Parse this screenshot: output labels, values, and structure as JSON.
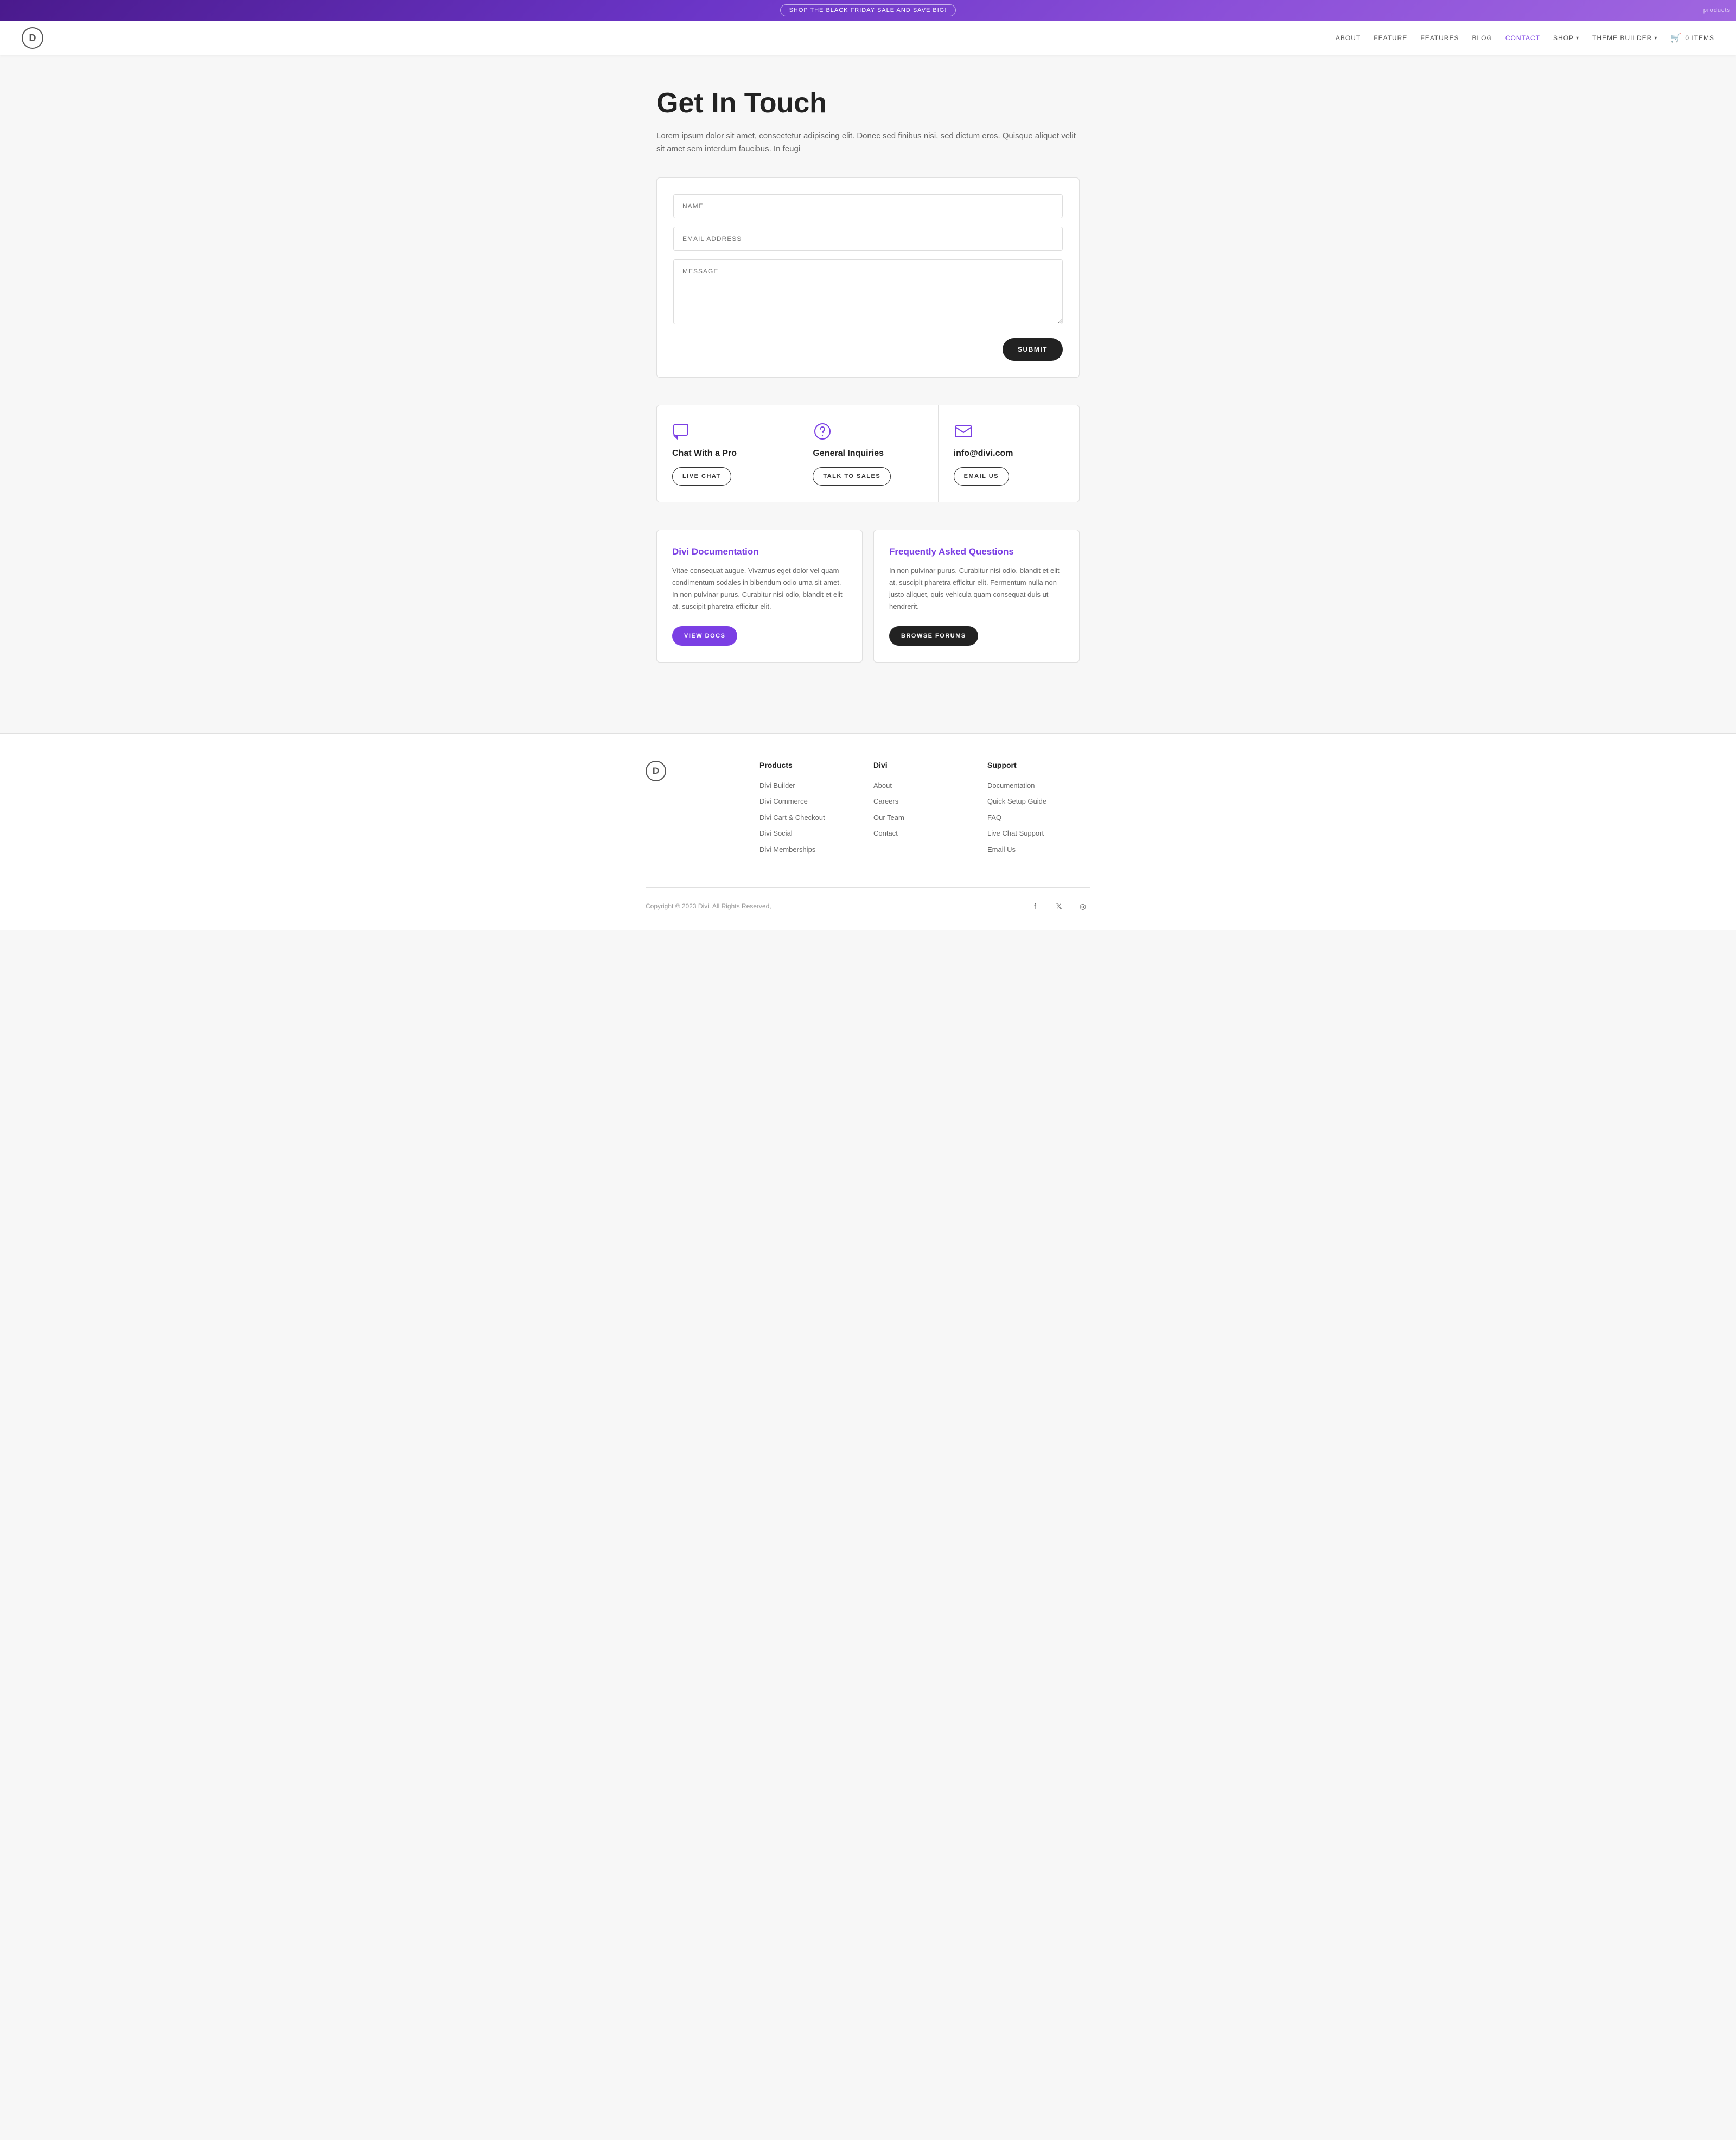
{
  "banner": {
    "text": "SHOP THE BLACK FRIDAY SALE AND SAVE BIG!",
    "corner": "products"
  },
  "header": {
    "logo": "D",
    "nav": [
      {
        "label": "ABOUT",
        "active": false,
        "href": "#"
      },
      {
        "label": "FEATURE",
        "active": false,
        "href": "#"
      },
      {
        "label": "FEATURES",
        "active": false,
        "href": "#"
      },
      {
        "label": "BLOG",
        "active": false,
        "href": "#"
      },
      {
        "label": "CONTACT",
        "active": true,
        "href": "#"
      },
      {
        "label": "SHOP",
        "active": false,
        "href": "#",
        "hasChevron": true
      },
      {
        "label": "THEME BUILDER",
        "active": false,
        "href": "#",
        "hasChevron": true
      }
    ],
    "cart": {
      "label": "0 ITEMS"
    }
  },
  "hero": {
    "title": "Get In Touch",
    "description": "Lorem ipsum dolor sit amet, consectetur adipiscing elit. Donec sed finibus nisi, sed dictum eros. Quisque aliquet velit sit amet sem interdum faucibus. In feugi"
  },
  "form": {
    "name_placeholder": "NAME",
    "email_placeholder": "EMAIL ADDRESS",
    "message_placeholder": "MESSAGE",
    "submit_label": "SUBMIT"
  },
  "contact_cards": [
    {
      "icon": "chat",
      "title": "Chat With a Pro",
      "button": "LIVE CHAT"
    },
    {
      "icon": "question",
      "title": "General Inquiries",
      "button": "TALK TO SALES"
    },
    {
      "icon": "email",
      "title": "info@divi.com",
      "button": "EMAIL US"
    }
  ],
  "doc_cards": [
    {
      "title": "Divi Documentation",
      "text": "Vitae consequat augue. Vivamus eget dolor vel quam condimentum sodales in bibendum odio urna sit amet. In non pulvinar purus. Curabitur nisi odio, blandit et elit at, suscipit pharetra efficitur elit.",
      "button": "VIEW DOCS",
      "style": "purple"
    },
    {
      "title": "Frequently Asked Questions",
      "text": "In non pulvinar purus. Curabitur nisi odio, blandit et elit at, suscipit pharetra efficitur elit. Fermentum nulla non justo aliquet, quis vehicula quam consequat duis ut hendrerit.",
      "button": "BROWSE FORUMS",
      "style": "dark"
    }
  ],
  "footer": {
    "logo": "D",
    "columns": [
      {
        "title": "Products",
        "links": [
          "Divi Builder",
          "Divi Commerce",
          "Divi Cart & Checkout",
          "Divi Social",
          "Divi Memberships"
        ]
      },
      {
        "title": "Divi",
        "links": [
          "About",
          "Careers",
          "Our Team",
          "Contact"
        ]
      },
      {
        "title": "Support",
        "links": [
          "Documentation",
          "Quick Setup Guide",
          "FAQ",
          "Live Chat Support",
          "Email Us"
        ]
      }
    ],
    "copyright": "Copyright © 2023 Divi. All Rights Reserved,",
    "social": [
      {
        "name": "facebook",
        "icon": "f"
      },
      {
        "name": "twitter-x",
        "icon": "𝕏"
      },
      {
        "name": "instagram",
        "icon": "◎"
      }
    ]
  }
}
